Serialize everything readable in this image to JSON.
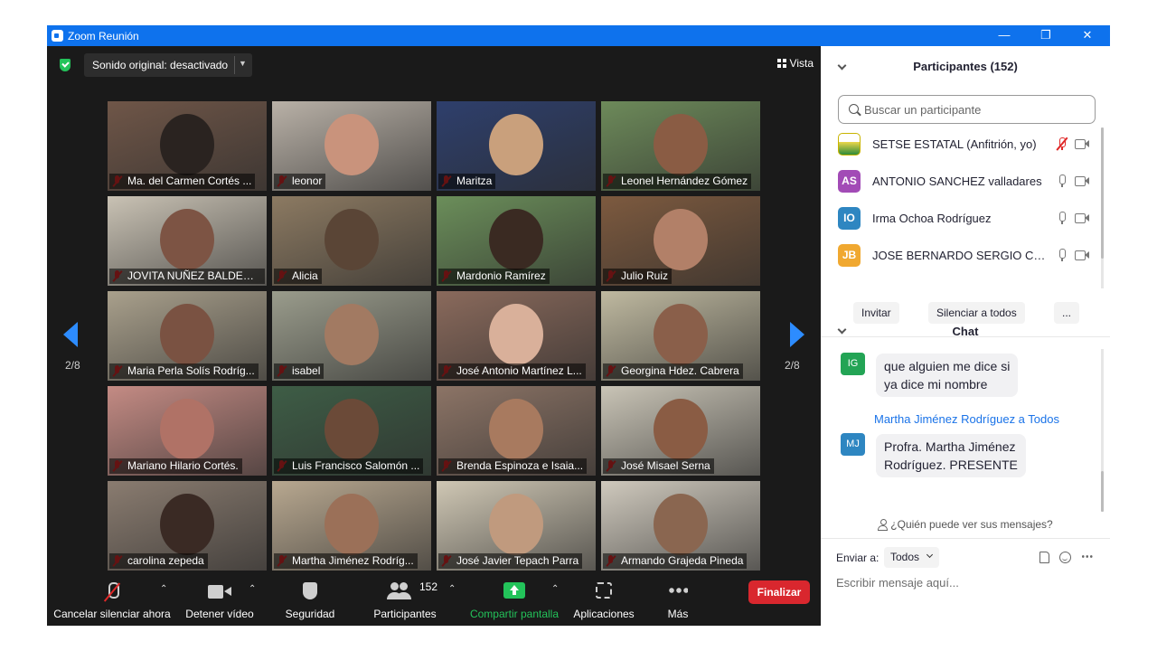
{
  "window": {
    "title": "Zoom Reunión",
    "minimize": "—",
    "restore": "❐",
    "close": "✕"
  },
  "topbar": {
    "sound_label": "Sonido original: desactivado",
    "view_label": "Vista"
  },
  "pager": {
    "left_page": "2/8",
    "right_page": "2/8"
  },
  "tiles": [
    {
      "name": "Ma. del Carmen Cortés ...",
      "bg": "#6f5648",
      "face": "#2a2320"
    },
    {
      "name": "leonor",
      "bg": "#b9b1a7",
      "face": "#c9937c"
    },
    {
      "name": "Maritza",
      "bg": "#2e3f6c",
      "face": "#c9a07c"
    },
    {
      "name": "Leonel Hernández Gómez",
      "bg": "#6d8a5a",
      "face": "#8a5c44"
    },
    {
      "name": "JOVITA NUÑEZ BALDERAS",
      "bg": "#c9c2b4",
      "face": "#7d5444"
    },
    {
      "name": "Alicia",
      "bg": "#8c7a62",
      "face": "#5a4536"
    },
    {
      "name": "Mardonio Ramírez",
      "bg": "#6b8e5a",
      "face": "#3a2a22"
    },
    {
      "name": "Julio Ruiz",
      "bg": "#7d5a3f",
      "face": "#b28068"
    },
    {
      "name": "Maria Perla Solís Rodríg...",
      "bg": "#a9a08c",
      "face": "#7a5242"
    },
    {
      "name": "isabel",
      "bg": "#9a9c8c",
      "face": "#a27a62"
    },
    {
      "name": "José Antonio Martínez L...",
      "bg": "#8a6a5c",
      "face": "#d9b09a"
    },
    {
      "name": "Georgina Hdez. Cabrera",
      "bg": "#bfb9a0",
      "face": "#8a5f4a"
    },
    {
      "name": "Mariano Hilario Cortés.",
      "bg": "#c48b84",
      "face": "#b07266"
    },
    {
      "name": "Luis Francisco Salomón ...",
      "bg": "#3e5d46",
      "face": "#6b4a38"
    },
    {
      "name": "Brenda Espinoza e Isaia...",
      "bg": "#8c7466",
      "face": "#a87a5f"
    },
    {
      "name": "José Misael Serna",
      "bg": "#c9c4b6",
      "face": "#8a5c44"
    },
    {
      "name": "carolina zepeda",
      "bg": "#8a7c70",
      "face": "#3a2a24"
    },
    {
      "name": "Martha  Jiménez Rodríg...",
      "bg": "#b8a890",
      "face": "#9b7058"
    },
    {
      "name": "José Javier Tepach Parra",
      "bg": "#cfc7b4",
      "face": "#c09a7e"
    },
    {
      "name": "Armando Grajeda Pineda",
      "bg": "#cfc9bd",
      "face": "#8a6650"
    }
  ],
  "toolbar": {
    "mute_label": "Cancelar silenciar ahora",
    "video_label": "Detener vídeo",
    "security_label": "Seguridad",
    "participants_label": "Participantes",
    "participants_count": "152",
    "share_label": "Compartir pantalla",
    "apps_label": "Aplicaciones",
    "more_label": "Más",
    "end_label": "Finalizar"
  },
  "participants": {
    "title": "Participantes (152)",
    "search_placeholder": "Buscar un participante",
    "list": [
      {
        "initials": "",
        "name": "SETSE ESTATAL (Anfitrión, yo)",
        "color": "#f2f2f2"
      },
      {
        "initials": "AS",
        "name": "ANTONIO SANCHEZ valladares",
        "color": "#a24bb6"
      },
      {
        "initials": "IO",
        "name": "Irma Ochoa Rodríguez",
        "color": "#2e86c1"
      },
      {
        "initials": "JB",
        "name": "JOSE BERNARDO SERGIO CARR...",
        "color": "#f0a830"
      }
    ],
    "invite_label": "Invitar",
    "mute_all_label": "Silenciar a todos",
    "more_label": "..."
  },
  "chat": {
    "title": "Chat",
    "messages": [
      {
        "initials": "IG",
        "color": "#23a455",
        "text_line1": "que alguien me dice si",
        "text_line2": "ya dice mi nombre"
      },
      {
        "initials": "MJ",
        "color": "#2e86c1",
        "sender": "Martha  Jiménez Rodríguez a Todos",
        "text_line1": "Profra. Martha Jiménez",
        "text_line2": "Rodríguez. PRESENTE"
      }
    ],
    "who_can_see": "¿Quién puede ver sus mensajes?",
    "send_to_label": "Enviar a:",
    "send_to_value": "Todos",
    "input_placeholder": "Escribir mensaje aquí..."
  }
}
